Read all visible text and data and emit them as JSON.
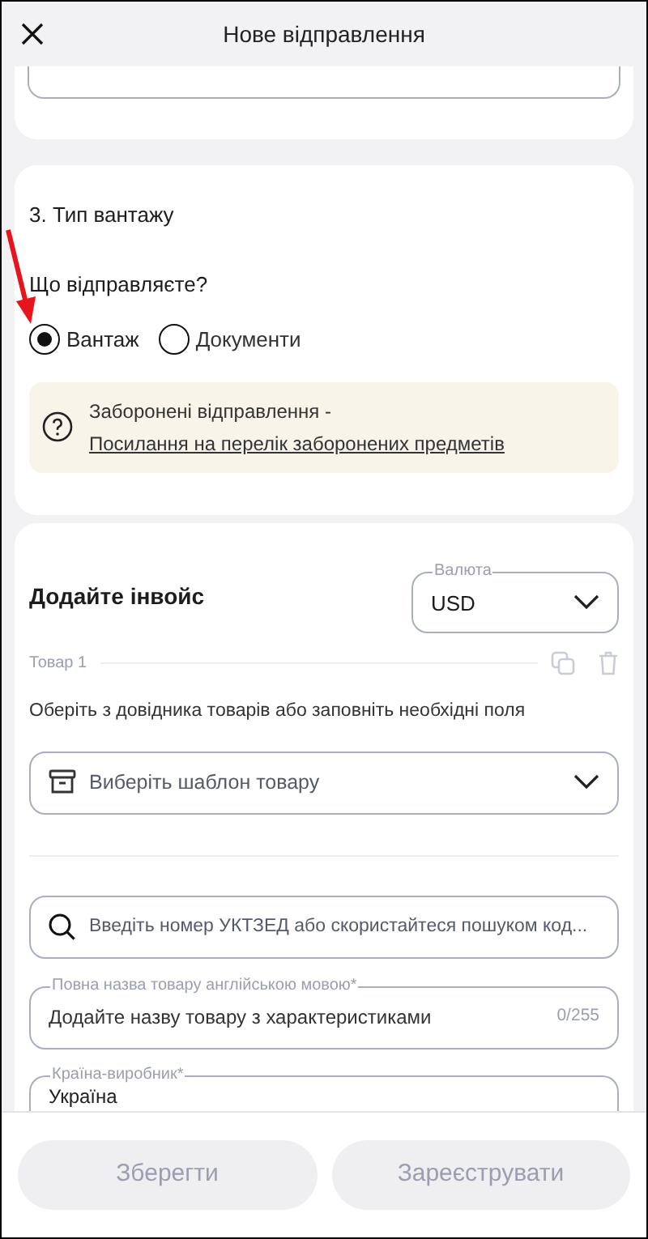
{
  "header": {
    "title": "Нове відправлення"
  },
  "cargo_section": {
    "title": "3. Тип вантажу",
    "question": "Що відправляєте?",
    "options": [
      {
        "label": "Вантаж",
        "selected": true
      },
      {
        "label": "Документи",
        "selected": false
      }
    ],
    "notice": {
      "text": "Заборонені відправлення - ",
      "link": "Посилання на перелік заборонених предметів"
    }
  },
  "invoice_section": {
    "title": "Додайте інвойс",
    "currency": {
      "label": "Валюта",
      "value": "USD"
    },
    "item_label": "Товар 1",
    "hint": "Оберіть з довідника товарів або заповніть необхідні поля",
    "template_select": {
      "placeholder": "Виберіть шаблон товару"
    },
    "code_search": {
      "placeholder": "Введіть номер УКТЗЕД або скористайтеся пошуком код..."
    },
    "name_field": {
      "label": "Повна назва товару англійською мовою*",
      "placeholder": "Додайте назву товару з характеристиками",
      "counter": "0/255"
    },
    "country_field": {
      "label": "Країна-виробник*",
      "value": "Україна"
    }
  },
  "footer": {
    "buttons": [
      {
        "label": "Зберегти",
        "disabled": true
      },
      {
        "label": "Зареєструвати",
        "disabled": true
      }
    ]
  }
}
